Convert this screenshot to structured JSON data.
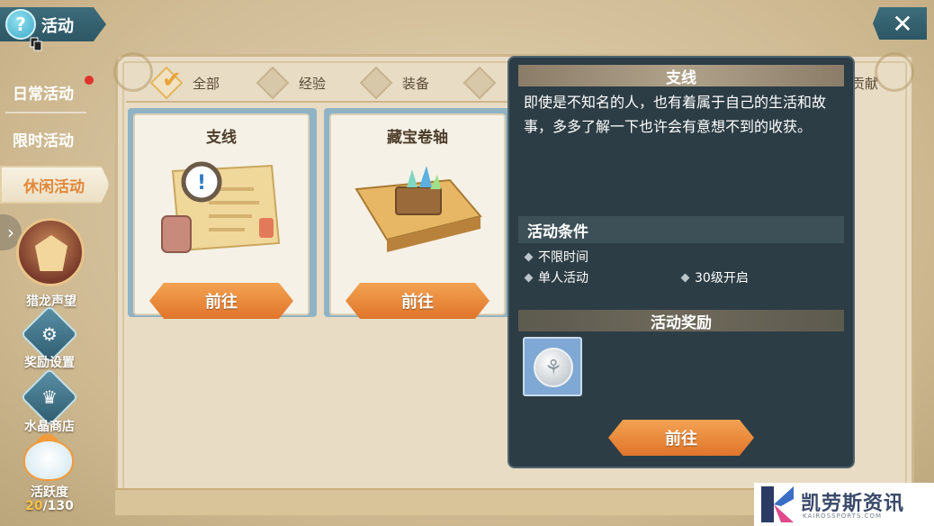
{
  "header": {
    "title": "活动",
    "close_icon": "close-icon",
    "help_icon": "help-icon"
  },
  "sidebar": {
    "items": [
      {
        "label": "日常活动",
        "has_badge": true
      },
      {
        "label": "限时活动"
      },
      {
        "label": "休闲活动",
        "active": true
      }
    ],
    "shortcuts": [
      {
        "label": "猎龙声望",
        "icon": "dragon-emblem-icon"
      },
      {
        "label": "奖励设置",
        "icon": "gear-icon"
      },
      {
        "label": "水晶商店",
        "icon": "crystal-shop-icon"
      },
      {
        "label": "活跃度",
        "icon": "mascot-icon"
      }
    ],
    "activity": {
      "current": "20",
      "total": "/130"
    }
  },
  "tabs": [
    {
      "label": "全部",
      "active": true
    },
    {
      "label": "经验"
    },
    {
      "label": "装备"
    },
    {
      "label": "贡献"
    }
  ],
  "cards": [
    {
      "title": "支线",
      "button": "前往",
      "art": "scroll-magnifier-icon"
    },
    {
      "title": "藏宝卷轴",
      "button": "前往",
      "art": "treasure-map-icon"
    }
  ],
  "detail": {
    "title": "支线",
    "description": "即使是不知名的人，也有着属于自己的生活和故事，多多了解一下也许会有意想不到的收获。",
    "conditions_title": "活动条件",
    "conditions": [
      "不限时间",
      "单人活动",
      "30级开启"
    ],
    "rewards_title": "活动奖励",
    "reward_icon": "silver-coin-icon",
    "button": "前往"
  },
  "watermark": {
    "text": "凯劳斯资讯",
    "sub": "KAIROSSPORTS.COM"
  },
  "colors": {
    "accent_orange": "#e0883a",
    "panel_dark": "#2d3d45",
    "button_orange": "#f3a251"
  }
}
